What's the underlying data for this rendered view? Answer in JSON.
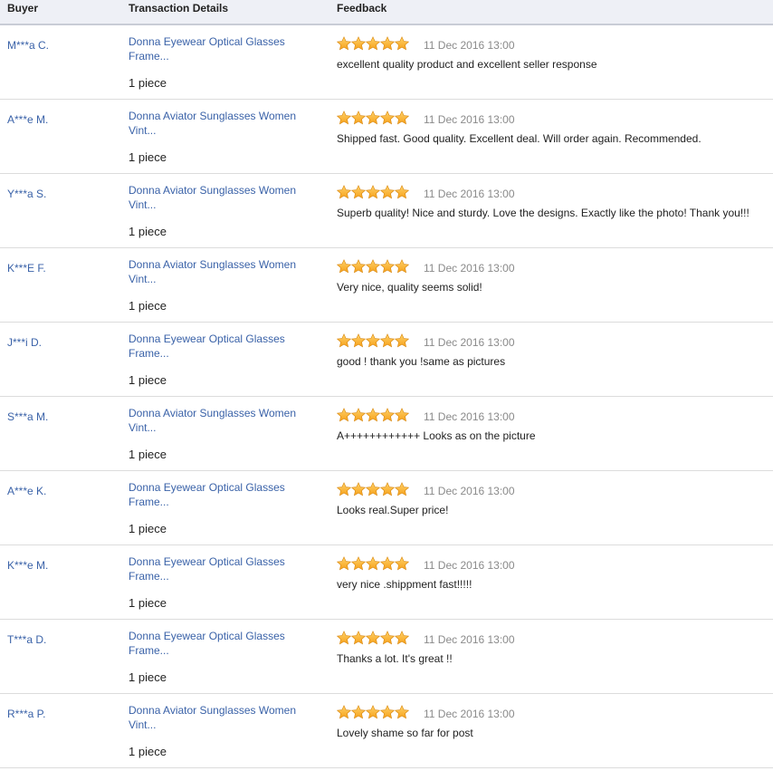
{
  "header": {
    "buyer": "Buyer",
    "transaction": "Transaction Details",
    "feedback": "Feedback"
  },
  "star_color": "#f6a01a",
  "rows": [
    {
      "buyer": "M***a C.",
      "product": "Donna Eyewear Optical Glasses Frame...",
      "qty": "1 piece",
      "stars": 5,
      "date": "11 Dec 2016 13:00",
      "text": "excellent quality product and excellent seller response"
    },
    {
      "buyer": "A***e M.",
      "product": "Donna Aviator Sunglasses Women Vint...",
      "qty": "1 piece",
      "stars": 5,
      "date": "11 Dec 2016 13:00",
      "text": "Shipped fast. Good quality. Excellent deal. Will order again. Recommended."
    },
    {
      "buyer": "Y***a S.",
      "product": "Donna Aviator Sunglasses Women Vint...",
      "qty": "1 piece",
      "stars": 5,
      "date": "11 Dec 2016 13:00",
      "text": "Superb quality! Nice and sturdy. Love the designs. Exactly like the photo! Thank you!!!"
    },
    {
      "buyer": "K***E F.",
      "product": "Donna Aviator Sunglasses Women Vint...",
      "qty": "1 piece",
      "stars": 5,
      "date": "11 Dec 2016 13:00",
      "text": "Very nice, quality seems solid!"
    },
    {
      "buyer": "J***i D.",
      "product": "Donna Eyewear Optical Glasses Frame...",
      "qty": "1 piece",
      "stars": 5,
      "date": "11 Dec 2016 13:00",
      "text": "good ! thank you !same as pictures"
    },
    {
      "buyer": "S***a M.",
      "product": "Donna Aviator Sunglasses Women Vint...",
      "qty": "1 piece",
      "stars": 5,
      "date": "11 Dec 2016 13:00",
      "text": "A++++++++++++ Looks as on the picture"
    },
    {
      "buyer": "A***e K.",
      "product": "Donna Eyewear Optical Glasses Frame...",
      "qty": "1 piece",
      "stars": 5,
      "date": "11 Dec 2016 13:00",
      "text": "Looks real.Super price!"
    },
    {
      "buyer": "K***e M.",
      "product": "Donna Eyewear Optical Glasses Frame...",
      "qty": "1 piece",
      "stars": 5,
      "date": "11 Dec 2016 13:00",
      "text": "very nice .shippment fast!!!!!"
    },
    {
      "buyer": "T***a D.",
      "product": "Donna Eyewear Optical Glasses Frame...",
      "qty": "1 piece",
      "stars": 5,
      "date": "11 Dec 2016 13:00",
      "text": "Thanks a lot. It's great !!"
    },
    {
      "buyer": "R***a P.",
      "product": "Donna Aviator Sunglasses Women Vint...",
      "qty": "1 piece",
      "stars": 5,
      "date": "11 Dec 2016 13:00",
      "text": "Lovely shame so far for post"
    }
  ]
}
